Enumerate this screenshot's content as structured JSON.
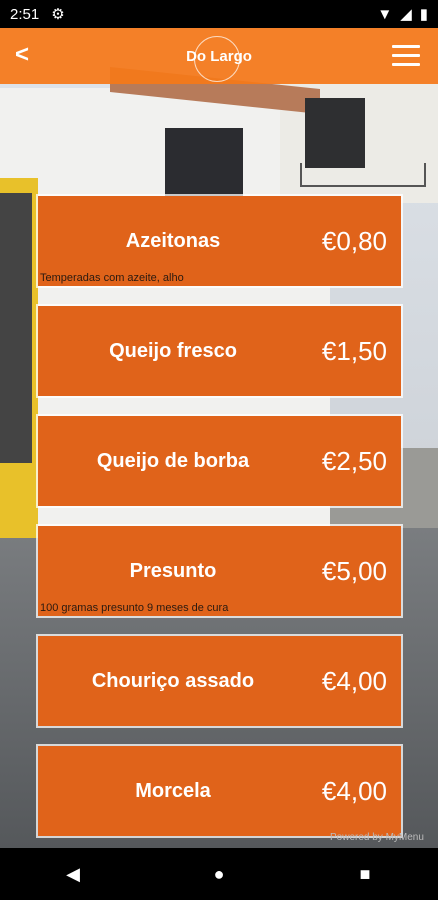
{
  "status": {
    "time": "2:51"
  },
  "header": {
    "back": "<",
    "logo": "Do Largo"
  },
  "items": [
    {
      "name": "Azeitonas",
      "price": "€0,80",
      "description": "Temperadas com azeite, alho"
    },
    {
      "name": "Queijo fresco",
      "price": "€1,50",
      "description": ""
    },
    {
      "name": "Queijo de borba",
      "price": "€2,50",
      "description": ""
    },
    {
      "name": "Presunto",
      "price": "€5,00",
      "description": "100 gramas presunto 9 meses de cura"
    },
    {
      "name": "Chouriço assado",
      "price": "€4,00",
      "description": ""
    },
    {
      "name": "Morcela",
      "price": "€4,00",
      "description": ""
    }
  ],
  "footer": {
    "powered": "Powered by MyMenu"
  },
  "colors": {
    "accent": "#f57819",
    "card": "#e0631a"
  }
}
